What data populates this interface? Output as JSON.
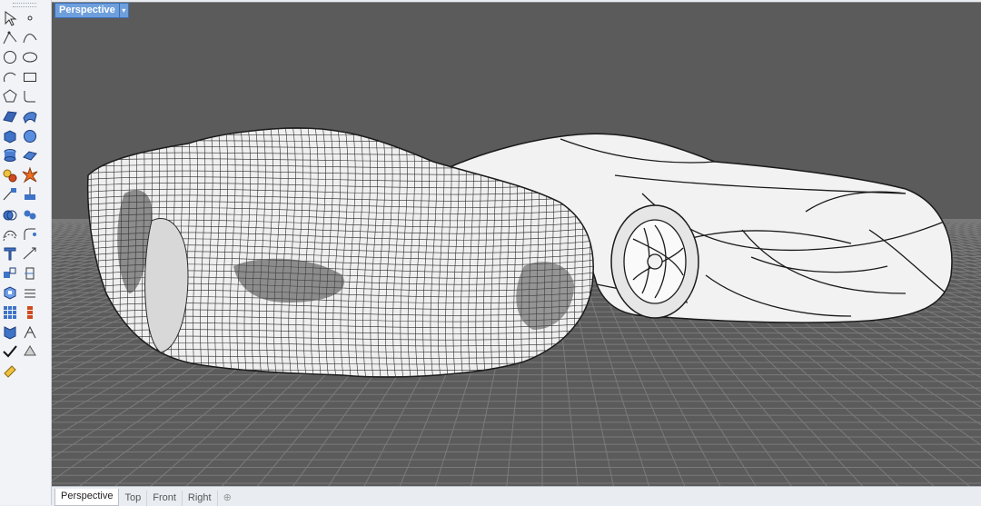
{
  "viewport": {
    "title": "Perspective",
    "menu_icon": "chevron-down-icon"
  },
  "tabs": [
    {
      "label": "Perspective",
      "active": true
    },
    {
      "label": "Top",
      "active": false
    },
    {
      "label": "Front",
      "active": false
    },
    {
      "label": "Right",
      "active": false
    }
  ],
  "tabs_add_icon": "plus-icon",
  "toolbar": {
    "tools": [
      "select-arrow-icon",
      "point-icon",
      "polyline-icon",
      "curve-icon",
      "circle-icon",
      "ellipse-icon",
      "arc-icon",
      "rectangle-icon",
      "polygon-icon",
      "fillet-curve-icon",
      "surface-plane-icon",
      "surface-loft-icon",
      "box-solid-icon",
      "sphere-solid-icon",
      "cylinder-solid-icon",
      "extrude-solid-icon",
      "mesh-tools-icon",
      "explode-icon",
      "trim-icon",
      "split-icon",
      "boolean-union-icon",
      "boolean-split-icon",
      "offset-curve-icon",
      "fillet-icon",
      "text-tool-icon",
      "dimension-icon",
      "transform-move-icon",
      "rotate-icon",
      "block-icon",
      "layout-icon",
      "array-icon",
      "rebuild-icon",
      "analyze-icon",
      "join-icon",
      "check-icon",
      "shade-icon",
      "render-icon"
    ]
  },
  "colors": {
    "viewport_bg": "#5b5b5b",
    "grid_line": "#7a7a7a",
    "title_active": "#6e9fdd",
    "model_fill": "#f2f2f2",
    "wire_line": "#1a1a1a"
  }
}
